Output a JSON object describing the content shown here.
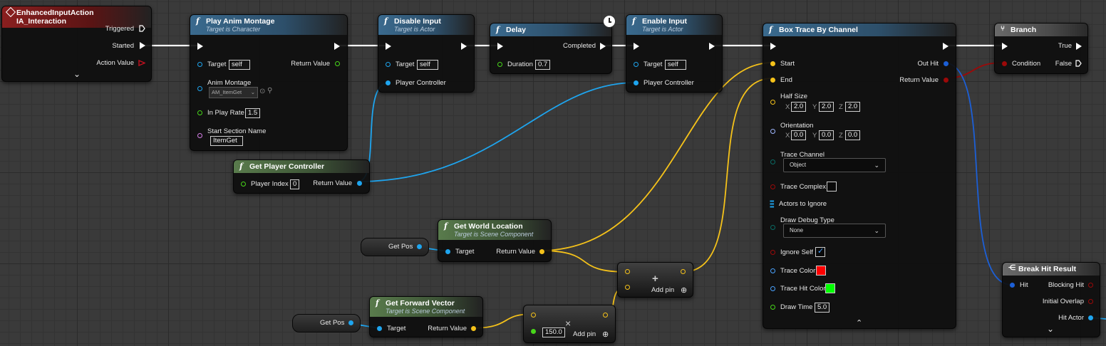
{
  "nodes": {
    "input_action": {
      "title": "EnhancedInputAction IA_Interaction",
      "pins": {
        "triggered": "Triggered",
        "started": "Started",
        "action_value": "Action Value"
      }
    },
    "play_montage": {
      "title": "Play Anim Montage",
      "subtitle": "Target is Character",
      "target": "Target",
      "target_value": "self",
      "return_value": "Return Value",
      "anim_montage": "Anim Montage",
      "montage_value": "AM_ItemGet",
      "play_rate": "In Play Rate",
      "play_rate_value": "1.5",
      "start_section": "Start Section Name",
      "start_section_value": "ItemGet"
    },
    "disable_input": {
      "title": "Disable Input",
      "subtitle": "Target is Actor",
      "target": "Target",
      "target_value": "self",
      "player_controller": "Player Controller"
    },
    "delay": {
      "title": "Delay",
      "completed": "Completed",
      "duration": "Duration",
      "duration_value": "0.7"
    },
    "enable_input": {
      "title": "Enable Input",
      "subtitle": "Target is Actor",
      "target": "Target",
      "target_value": "self",
      "player_controller": "Player Controller"
    },
    "get_player_controller": {
      "title": "Get Player Controller",
      "player_index": "Player Index",
      "player_index_value": "0",
      "return_value": "Return Value"
    },
    "get_world_location": {
      "title": "Get World Location",
      "subtitle": "Target is Scene Component",
      "target": "Target",
      "return_value": "Return Value"
    },
    "get_forward_vector": {
      "title": "Get Forward Vector",
      "subtitle": "Target is Scene Component",
      "target": "Target",
      "return_value": "Return Value"
    },
    "get_pos_1": {
      "label": "Get Pos"
    },
    "get_pos_2": {
      "label": "Get Pos"
    },
    "add_node": {
      "add_pin": "Add pin",
      "plus": "+"
    },
    "multiply_node": {
      "add_pin": "Add pin",
      "value": "150.0",
      "times": "×"
    },
    "box_trace": {
      "title": "Box Trace By Channel",
      "start": "Start",
      "end": "End",
      "out_hit": "Out Hit",
      "return_value": "Return Value",
      "half_size": "Half Size",
      "half_size_x": "2.0",
      "half_size_y": "2.0",
      "half_size_z": "2.0",
      "orientation": "Orientation",
      "orientation_x": "0.0",
      "orientation_y": "0.0",
      "orientation_z": "0.0",
      "trace_channel": "Trace Channel",
      "trace_channel_value": "Object",
      "trace_complex": "Trace Complex",
      "actors_to_ignore": "Actors to Ignore",
      "draw_debug_type": "Draw Debug Type",
      "draw_debug_value": "None",
      "ignore_self": "Ignore Self",
      "trace_color": "Trace Color",
      "trace_hit_color": "Trace Hit Color",
      "draw_time": "Draw Time",
      "draw_time_value": "5.0",
      "trace_color_hex": "#ff0000",
      "trace_hit_color_hex": "#00ff00"
    },
    "branch": {
      "title": "Branch",
      "condition": "Condition",
      "true": "True",
      "false": "False"
    },
    "break_hit": {
      "title": "Break Hit Result",
      "hit": "Hit",
      "blocking_hit": "Blocking Hit",
      "initial_overlap": "Initial Overlap",
      "hit_actor": "Hit Actor"
    }
  },
  "axis_labels": {
    "x": "X",
    "y": "Y",
    "z": "Z"
  },
  "icons": {
    "function": "f",
    "expand": "⌄",
    "collapse": "⌃",
    "clock": "clock-icon",
    "branch": "branch-icon",
    "break": "break-icon",
    "event": "event-icon"
  }
}
